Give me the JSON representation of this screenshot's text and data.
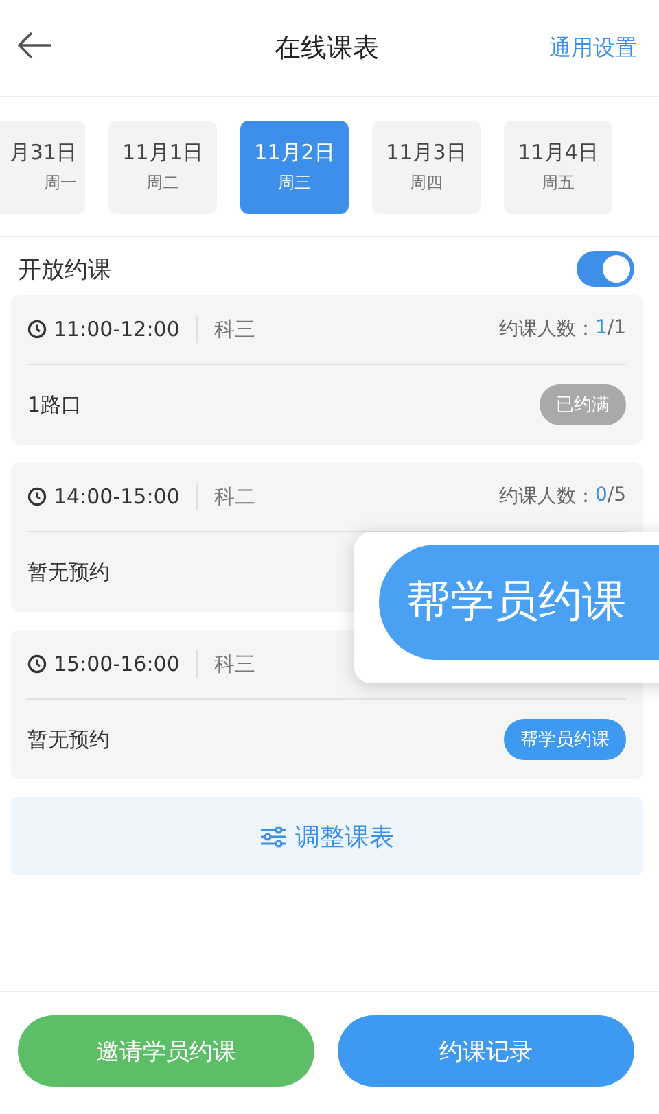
{
  "header": {
    "title": "在线课表",
    "action": "通用设置"
  },
  "dates": [
    {
      "date": "月31日",
      "weekday": "周一",
      "selected": false
    },
    {
      "date": "11月1日",
      "weekday": "周二",
      "selected": false
    },
    {
      "date": "11月2日",
      "weekday": "周三",
      "selected": true
    },
    {
      "date": "11月3日",
      "weekday": "周四",
      "selected": false
    },
    {
      "date": "11月4日",
      "weekday": "周五",
      "selected": false
    }
  ],
  "open_booking": {
    "label": "开放约课",
    "on": true
  },
  "slots": [
    {
      "time": "11:00-12:00",
      "subject": "科三",
      "count_label": "约课人数：",
      "booked": "1",
      "limit": "/1",
      "status": "1路口",
      "action": {
        "kind": "full",
        "label": "已约满"
      }
    },
    {
      "time": "14:00-15:00",
      "subject": "科二",
      "count_label": "约课人数：",
      "booked": "0",
      "limit": "/5",
      "status": "暂无预约"
    },
    {
      "time": "15:00-16:00",
      "subject": "科三",
      "status": "暂无预约",
      "action": {
        "kind": "book",
        "label": "帮学员约课"
      }
    }
  ],
  "adjust_button": "调整课表",
  "magnifier": {
    "label": "帮学员约课"
  },
  "footer": [
    {
      "kind": "invite",
      "label": "邀请学员约课"
    },
    {
      "kind": "records",
      "label": "约课记录"
    }
  ]
}
